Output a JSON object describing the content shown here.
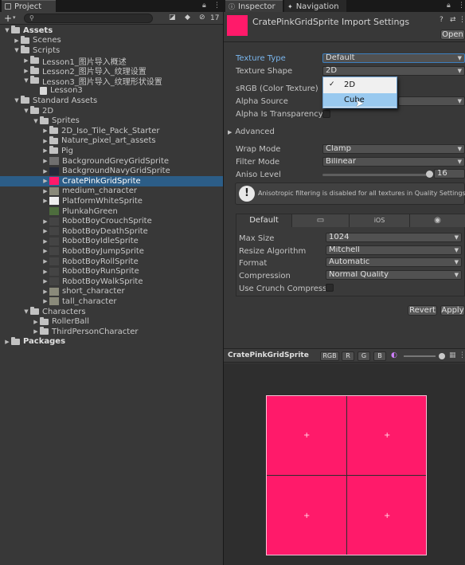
{
  "project": {
    "tab_label": "Project",
    "add_label": "+",
    "hidden_count": "17",
    "tree": [
      {
        "label": "Assets",
        "depth": 0,
        "expanded": true,
        "type": "folder",
        "bold": true
      },
      {
        "label": "Scenes",
        "depth": 1,
        "expanded": false,
        "type": "folder"
      },
      {
        "label": "Scripts",
        "depth": 1,
        "expanded": true,
        "type": "folder"
      },
      {
        "label": "Lesson1_图片导入概述",
        "depth": 2,
        "expanded": false,
        "type": "folder"
      },
      {
        "label": "Lesson2_图片导入_纹理设置",
        "depth": 2,
        "expanded": false,
        "type": "folder"
      },
      {
        "label": "Lesson3_图片导入_纹理形状设置",
        "depth": 2,
        "expanded": true,
        "type": "folder"
      },
      {
        "label": "Lesson3",
        "depth": 3,
        "expanded": null,
        "type": "script"
      },
      {
        "label": "Standard Assets",
        "depth": 1,
        "expanded": true,
        "type": "folder"
      },
      {
        "label": "2D",
        "depth": 2,
        "expanded": true,
        "type": "folder"
      },
      {
        "label": "Sprites",
        "depth": 3,
        "expanded": true,
        "type": "folder"
      },
      {
        "label": "2D_Iso_Tile_Pack_Starter",
        "depth": 4,
        "expanded": false,
        "type": "folder"
      },
      {
        "label": "Nature_pixel_art_assets",
        "depth": 4,
        "expanded": false,
        "type": "folder"
      },
      {
        "label": "Pig",
        "depth": 4,
        "expanded": false,
        "type": "folder"
      },
      {
        "label": "BackgroundGreyGridSprite",
        "depth": 4,
        "expanded": false,
        "type": "sprite",
        "swatch": "#6f6f6f"
      },
      {
        "label": "BackgroundNavyGridSprite",
        "depth": 4,
        "expanded": false,
        "type": "sprite",
        "swatch": "#22293a"
      },
      {
        "label": "CratePinkGridSprite",
        "depth": 4,
        "expanded": false,
        "type": "sprite",
        "swatch": "#ff1a6a",
        "selected": true
      },
      {
        "label": "medium_character",
        "depth": 4,
        "expanded": false,
        "type": "sprite",
        "swatch": "#8a8a7a"
      },
      {
        "label": "PlatformWhiteSprite",
        "depth": 4,
        "expanded": false,
        "type": "sprite",
        "swatch": "#eeeeee"
      },
      {
        "label": "PlunkahGreen",
        "depth": 4,
        "expanded": null,
        "type": "sprite",
        "swatch": "#4d6d3d"
      },
      {
        "label": "RobotBoyCrouchSprite",
        "depth": 4,
        "expanded": false,
        "type": "sprite",
        "swatch": "#444444"
      },
      {
        "label": "RobotBoyDeathSprite",
        "depth": 4,
        "expanded": false,
        "type": "sprite",
        "swatch": "#444444"
      },
      {
        "label": "RobotBoyIdleSprite",
        "depth": 4,
        "expanded": false,
        "type": "sprite",
        "swatch": "#444444"
      },
      {
        "label": "RobotBoyJumpSprite",
        "depth": 4,
        "expanded": false,
        "type": "sprite",
        "swatch": "#444444"
      },
      {
        "label": "RobotBoyRollSprite",
        "depth": 4,
        "expanded": false,
        "type": "sprite",
        "swatch": "#444444"
      },
      {
        "label": "RobotBoyRunSprite",
        "depth": 4,
        "expanded": false,
        "type": "sprite",
        "swatch": "#444444"
      },
      {
        "label": "RobotBoyWalkSprite",
        "depth": 4,
        "expanded": false,
        "type": "sprite",
        "swatch": "#444444"
      },
      {
        "label": "short_character",
        "depth": 4,
        "expanded": false,
        "type": "sprite",
        "swatch": "#8a8a7a"
      },
      {
        "label": "tall_character",
        "depth": 4,
        "expanded": false,
        "type": "sprite",
        "swatch": "#8a8a7a"
      },
      {
        "label": "Characters",
        "depth": 2,
        "expanded": true,
        "type": "folder"
      },
      {
        "label": "RollerBall",
        "depth": 3,
        "expanded": false,
        "type": "folder"
      },
      {
        "label": "ThirdPersonCharacter",
        "depth": 3,
        "expanded": false,
        "type": "folder"
      },
      {
        "label": "Packages",
        "depth": 0,
        "expanded": false,
        "type": "folder",
        "bold": true
      }
    ]
  },
  "inspector": {
    "tabs": [
      "Inspector",
      "Navigation"
    ],
    "asset_title": "CratePinkGridSprite Import Settings",
    "asset_color": "#ff1a6a",
    "open_label": "Open",
    "texture_type_label": "Texture Type",
    "texture_type_value": "Default",
    "texture_shape_label": "Texture Shape",
    "texture_shape_value": "2D",
    "dropdown_options": [
      "2D",
      "Cube"
    ],
    "srgb_label": "sRGB (Color Texture)",
    "alpha_source_label": "Alpha Source",
    "alpha_transparency_label": "Alpha Is Transparency",
    "advanced_label": "Advanced",
    "wrap_mode_label": "Wrap Mode",
    "wrap_mode_value": "Clamp",
    "filter_mode_label": "Filter Mode",
    "filter_mode_value": "Bilinear",
    "aniso_label": "Aniso Level",
    "aniso_value": "16",
    "warning_text": "Anisotropic filtering is disabled for all textures in Quality Settings.",
    "platform_tabs": [
      "Default",
      "",
      "iOS",
      ""
    ],
    "max_size_label": "Max Size",
    "max_size_value": "1024",
    "resize_label": "Resize Algorithm",
    "resize_value": "Mitchell",
    "format_label": "Format",
    "format_value": "Automatic",
    "compression_label": "Compression",
    "compression_value": "Normal Quality",
    "crunch_label": "Use Crunch Compressio",
    "revert_label": "Revert",
    "apply_label": "Apply"
  },
  "preview": {
    "title": "CratePinkGridSprite",
    "channels": [
      "RGB",
      "R",
      "G",
      "B"
    ],
    "sprite_color": "#ff1a6a"
  }
}
